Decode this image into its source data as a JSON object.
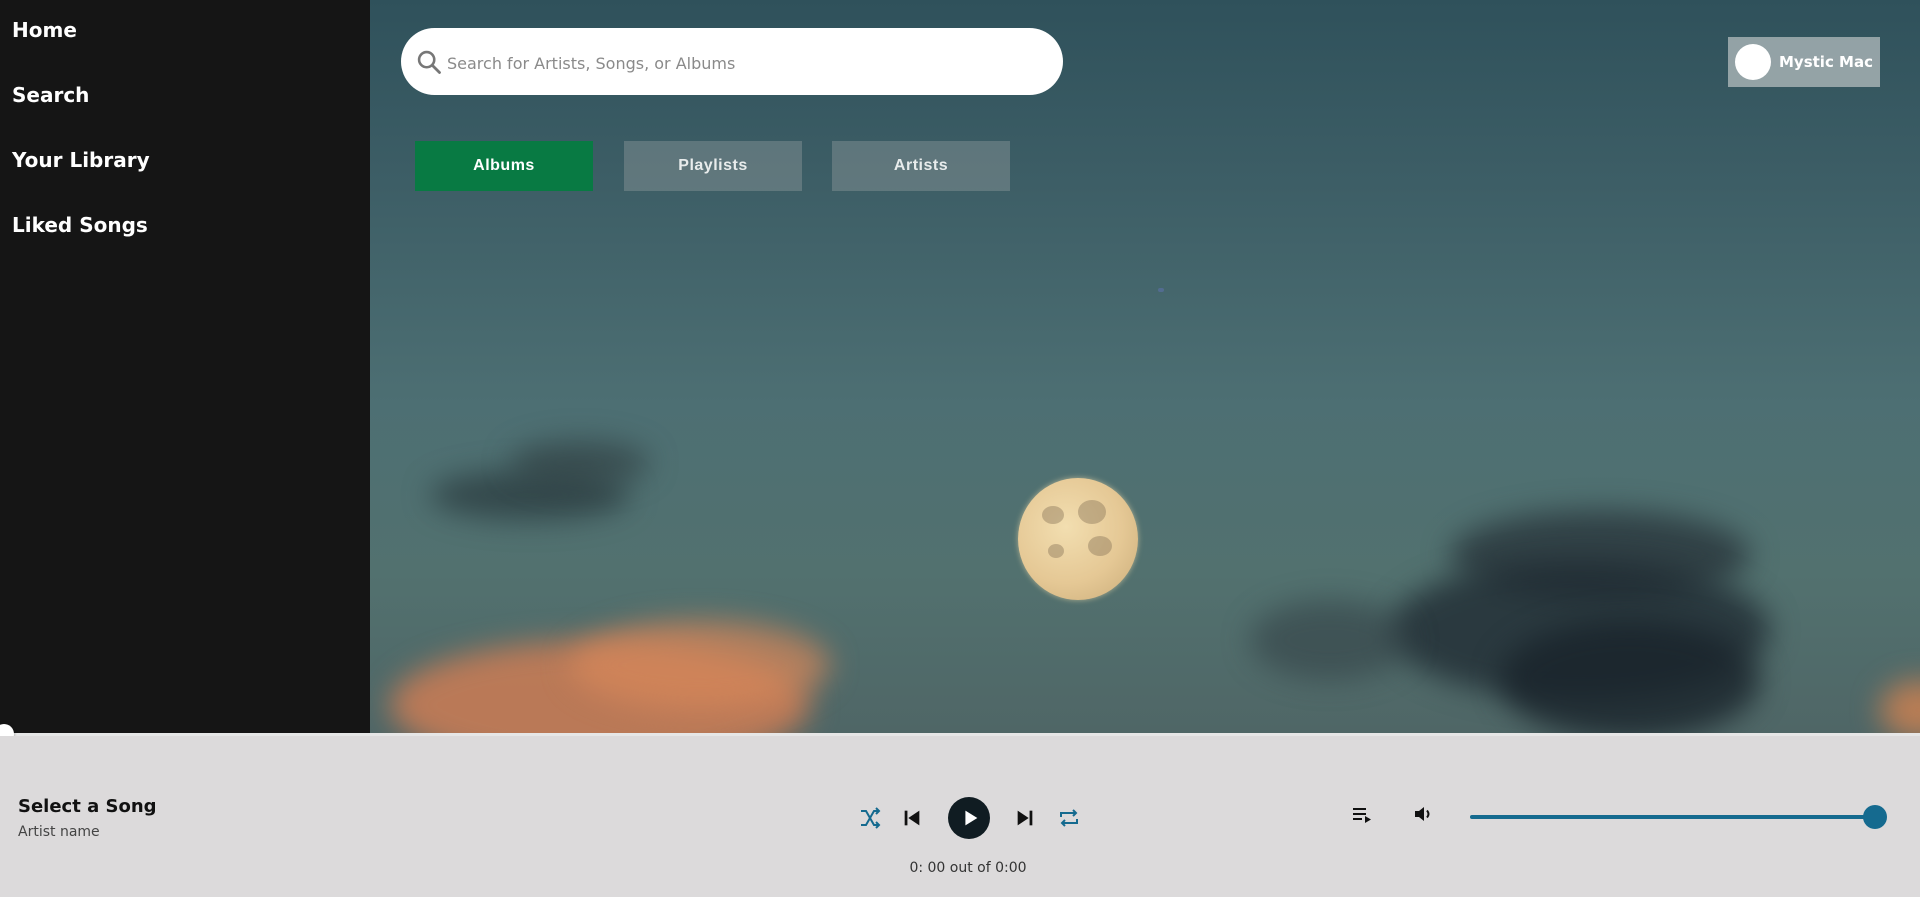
{
  "sidebar": {
    "items": [
      {
        "label": "Home"
      },
      {
        "label": "Search"
      },
      {
        "label": "Your Library"
      },
      {
        "label": "Liked Songs"
      }
    ]
  },
  "search": {
    "placeholder": "Search for Artists, Songs, or Albums",
    "value": ""
  },
  "tabs": [
    {
      "label": "Albums",
      "active": true
    },
    {
      "label": "Playlists",
      "active": false
    },
    {
      "label": "Artists",
      "active": false
    }
  ],
  "user": {
    "name": "Mystic Mac"
  },
  "player": {
    "song_title": "Select a Song",
    "artist": "Artist name",
    "time_text": "0: 00 out of 0:00",
    "progress": 0,
    "volume": 1.0,
    "controls": [
      "shuffle-icon",
      "previous-icon",
      "play-icon",
      "next-icon",
      "repeat-icon"
    ],
    "right_controls": [
      "queue-icon",
      "volume-icon"
    ]
  },
  "colors": {
    "accent_green": "#087a43",
    "player_accent": "#156a8f",
    "sidebar_bg": "#151515",
    "player_bg": "#dcdadb"
  }
}
